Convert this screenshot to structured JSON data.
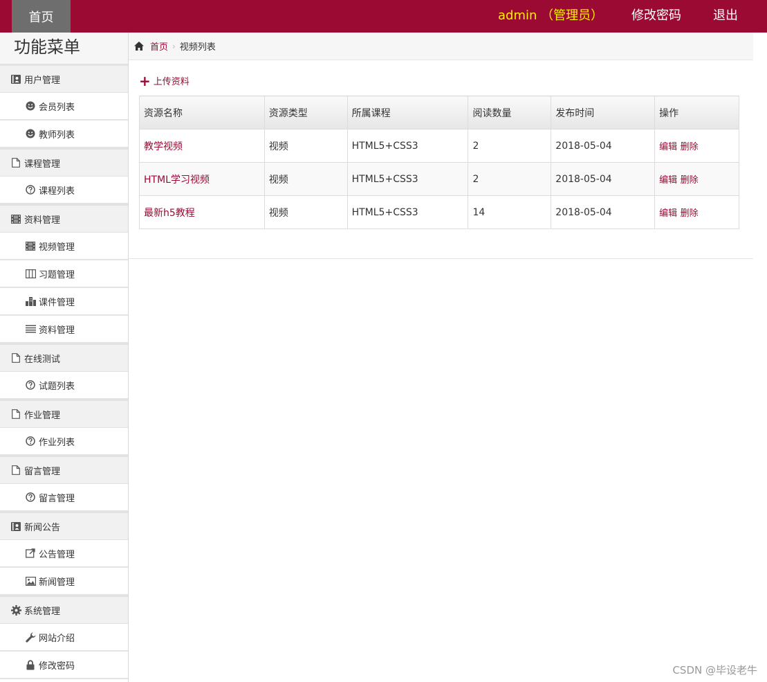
{
  "topbar": {
    "home_label": "首页",
    "user_label": "admin （管理员）",
    "change_password": "修改密码",
    "logout": "退出",
    "accent_color": "#9b0a33"
  },
  "sidebar": {
    "title": "功能菜单",
    "groups": [
      {
        "label": "用户管理",
        "icon": "contact-card-icon",
        "items": [
          {
            "label": "会员列表",
            "icon": "smile-icon"
          },
          {
            "label": "教师列表",
            "icon": "smile-icon"
          }
        ]
      },
      {
        "label": "课程管理",
        "icon": "file-icon",
        "items": [
          {
            "label": "课程列表",
            "icon": "question-circle-icon"
          }
        ]
      },
      {
        "label": "资料管理",
        "icon": "film-icon",
        "items": [
          {
            "label": "视频管理",
            "icon": "film-icon"
          },
          {
            "label": "习题管理",
            "icon": "columns-icon"
          },
          {
            "label": "课件管理",
            "icon": "buildings-icon"
          },
          {
            "label": "资料管理",
            "icon": "list-icon"
          }
        ]
      },
      {
        "label": "在线测试",
        "icon": "file-icon",
        "items": [
          {
            "label": "试题列表",
            "icon": "question-circle-icon"
          }
        ]
      },
      {
        "label": "作业管理",
        "icon": "file-icon",
        "items": [
          {
            "label": "作业列表",
            "icon": "question-circle-icon"
          }
        ]
      },
      {
        "label": "留言管理",
        "icon": "file-icon",
        "items": [
          {
            "label": "留言管理",
            "icon": "question-circle-icon"
          }
        ]
      },
      {
        "label": "新闻公告",
        "icon": "contact-card-icon",
        "items": [
          {
            "label": "公告管理",
            "icon": "share-box-icon"
          },
          {
            "label": "新闻管理",
            "icon": "picture-icon"
          }
        ]
      },
      {
        "label": "系统管理",
        "icon": "gear-icon",
        "items": [
          {
            "label": "网站介绍",
            "icon": "wrench-icon"
          },
          {
            "label": "修改密码",
            "icon": "lock-icon"
          }
        ]
      }
    ]
  },
  "breadcrumb": {
    "home": "首页",
    "current": "视频列表"
  },
  "upload_label": "上传资料",
  "table": {
    "headers": [
      "资源名称",
      "资源类型",
      "所属课程",
      "阅读数量",
      "发布时间",
      "操作"
    ],
    "rows": [
      {
        "name": "教学视频",
        "type": "视频",
        "course": "HTML5+CSS3",
        "reads": "2",
        "date": "2018-05-04",
        "edit": "编辑",
        "delete": "删除"
      },
      {
        "name": "HTML学习视频",
        "type": "视频",
        "course": "HTML5+CSS3",
        "reads": "2",
        "date": "2018-05-04",
        "edit": "编辑",
        "delete": "删除"
      },
      {
        "name": "最新h5教程",
        "type": "视频",
        "course": "HTML5+CSS3",
        "reads": "14",
        "date": "2018-05-04",
        "edit": "编辑",
        "delete": "删除"
      }
    ]
  },
  "watermark": "CSDN @毕设老牛"
}
